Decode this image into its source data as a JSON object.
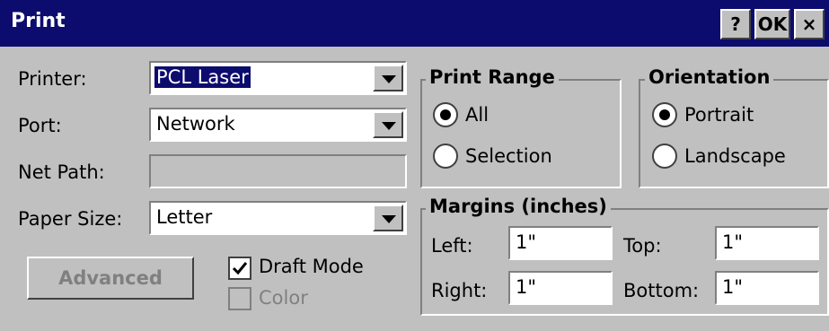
{
  "window": {
    "title": "Print",
    "help_label": "?",
    "ok_label": "OK",
    "close_label": "×"
  },
  "form": {
    "printer_label": "Printer:",
    "printer_value": "PCL Laser",
    "port_label": "Port:",
    "port_value": "Network",
    "netpath_label": "Net Path:",
    "netpath_value": "",
    "papersize_label": "Paper Size:",
    "papersize_value": "Letter",
    "advanced_label": "Advanced",
    "draft_label": "Draft Mode",
    "draft_checked": true,
    "color_label": "Color",
    "color_checked": false
  },
  "print_range": {
    "title": "Print Range",
    "options": [
      {
        "label": "All",
        "selected": true
      },
      {
        "label": "Selection",
        "selected": false
      }
    ]
  },
  "orientation": {
    "title": "Orientation",
    "options": [
      {
        "label": "Portrait",
        "selected": true
      },
      {
        "label": "Landscape",
        "selected": false
      }
    ]
  },
  "margins": {
    "title": "Margins (inches)",
    "left_label": "Left:",
    "left_value": "1\"",
    "top_label": "Top:",
    "top_value": "1\"",
    "right_label": "Right:",
    "right_value": "1\"",
    "bottom_label": "Bottom:",
    "bottom_value": "1\""
  }
}
